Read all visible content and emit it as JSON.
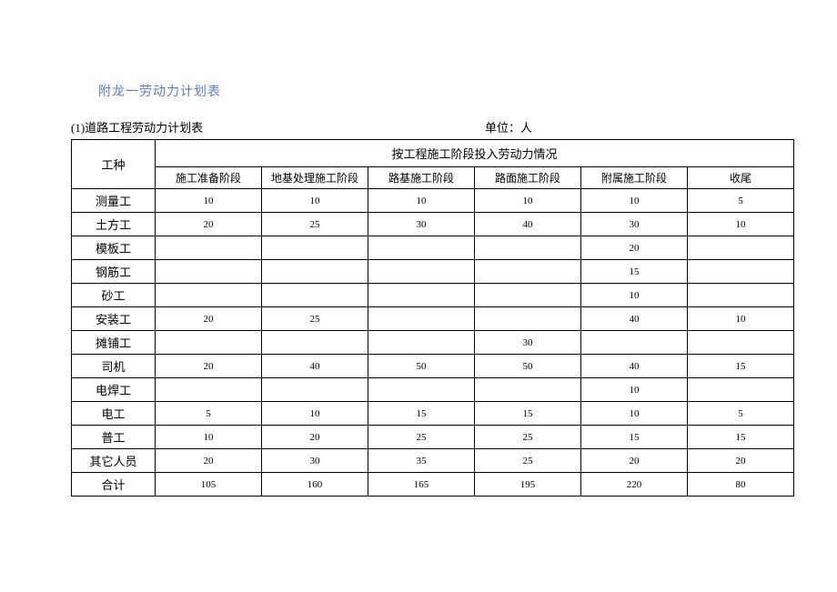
{
  "title": "附龙一劳动力计划表",
  "subtitle_left": "(1)道路工程劳动力计划表",
  "subtitle_right": "单位：人",
  "header": {
    "worktype": "工种",
    "section": "按工程施工阶段投入劳动力情况",
    "stages": [
      "施工准备阶段",
      "地基处理施工阶段",
      "路基施工阶段",
      "路面施工阶段",
      "附属施工阶段",
      "收尾"
    ]
  },
  "rows": [
    {
      "label": "测量工",
      "values": [
        "10",
        "10",
        "10",
        "10",
        "10",
        "5"
      ]
    },
    {
      "label": "土方工",
      "values": [
        "20",
        "25",
        "30",
        "40",
        "30",
        "10"
      ]
    },
    {
      "label": "模板工",
      "values": [
        "",
        "",
        "",
        "",
        "20",
        ""
      ]
    },
    {
      "label": "钢筋工",
      "values": [
        "",
        "",
        "",
        "",
        "15",
        ""
      ]
    },
    {
      "label": "砂工",
      "values": [
        "",
        "",
        "",
        "",
        "10",
        ""
      ]
    },
    {
      "label": "安装工",
      "values": [
        "20",
        "25",
        "",
        "",
        "40",
        "10"
      ]
    },
    {
      "label": "摊铺工",
      "values": [
        "",
        "",
        "",
        "30",
        "",
        ""
      ]
    },
    {
      "label": "司机",
      "values": [
        "20",
        "40",
        "50",
        "50",
        "40",
        "15"
      ]
    },
    {
      "label": "电焊工",
      "values": [
        "",
        "",
        "",
        "",
        "10",
        ""
      ]
    },
    {
      "label": "电工",
      "values": [
        "5",
        "10",
        "15",
        "15",
        "10",
        "5"
      ]
    },
    {
      "label": "普工",
      "values": [
        "10",
        "20",
        "25",
        "25",
        "15",
        "15"
      ]
    },
    {
      "label": "其它人员",
      "values": [
        "20",
        "30",
        "35",
        "25",
        "20",
        "20"
      ]
    },
    {
      "label": "合计",
      "values": [
        "105",
        "160",
        "165",
        "195",
        "220",
        "80"
      ]
    }
  ]
}
